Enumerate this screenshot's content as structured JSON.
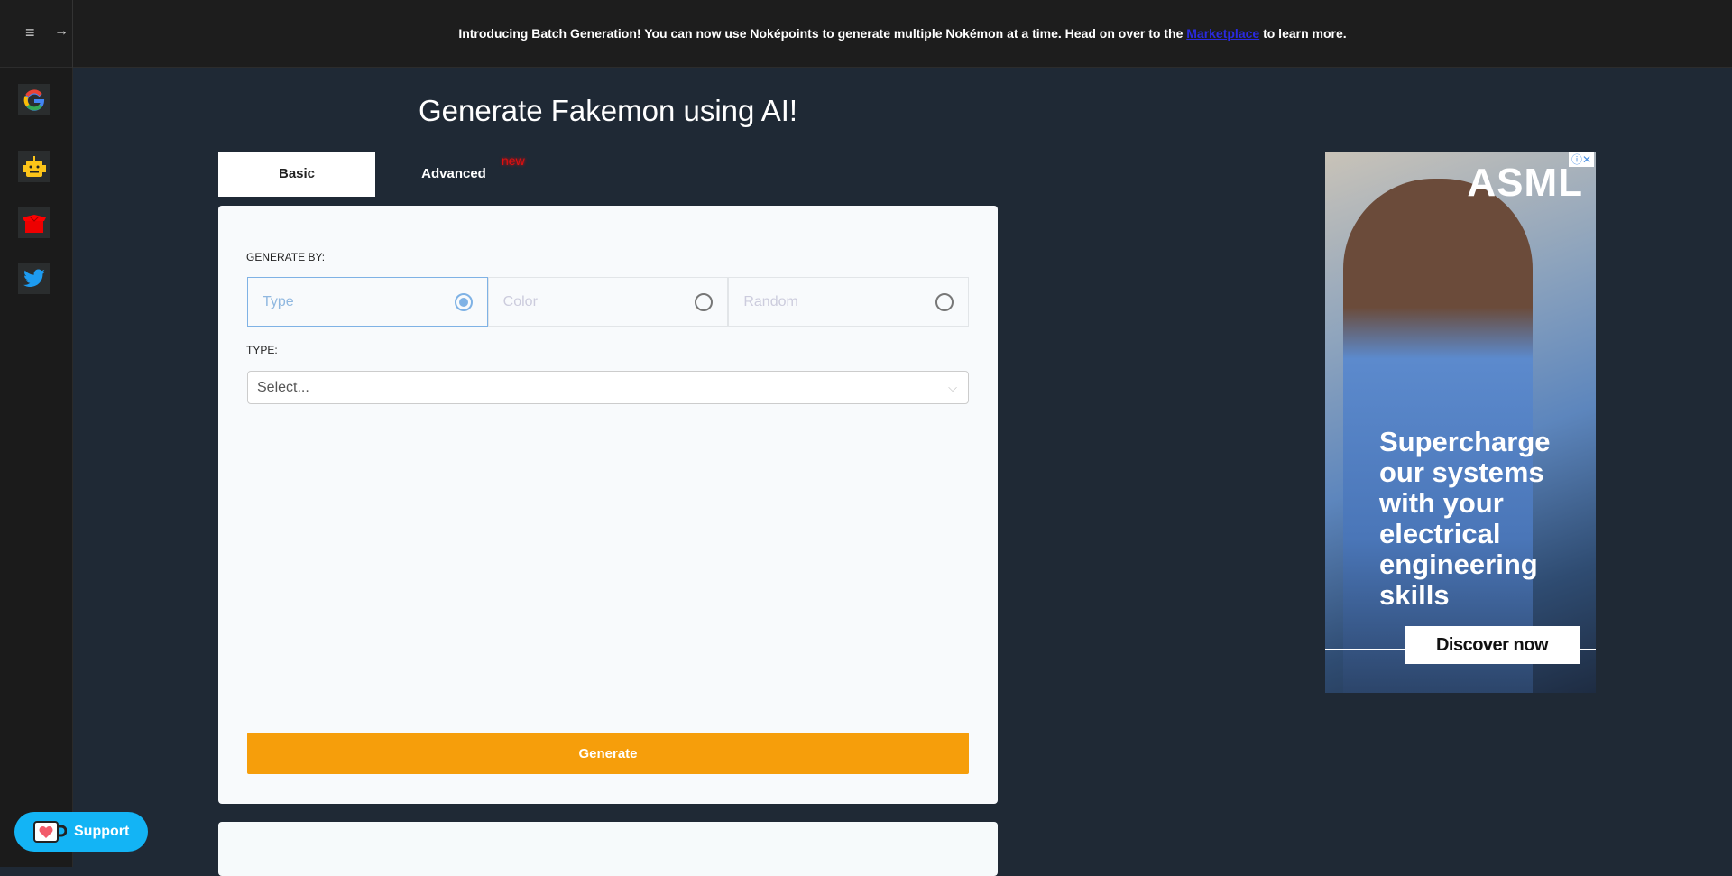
{
  "banner": {
    "text_before": "Introducing Batch Generation! You can now use Noképoints to generate multiple Nokémon at a time. Head on over to the",
    "link": "Marketplace",
    "text_after": "to learn more."
  },
  "topleft": {
    "menu_icon": "hamburger-icon",
    "expand_icon": "arrow-right-icon"
  },
  "sidebar": {
    "items": [
      {
        "icon": "google-icon"
      },
      {
        "icon": "robot-icon"
      },
      {
        "icon": "gift-box-icon"
      },
      {
        "icon": "twitter-icon"
      }
    ]
  },
  "main": {
    "title": "Generate Fakemon using AI!",
    "tabs": [
      {
        "label": "Basic",
        "active": true
      },
      {
        "label": "Advanced",
        "badge": "new"
      }
    ],
    "generate_by_label": "GENERATE BY:",
    "options": [
      {
        "label": "Type",
        "selected": true
      },
      {
        "label": "Color",
        "selected": false
      },
      {
        "label": "Random",
        "selected": false
      }
    ],
    "type_label": "TYPE:",
    "type_select_placeholder": "Select...",
    "generate_button": "Generate",
    "accent": "#f69e0b"
  },
  "ad": {
    "brand": "ASML",
    "headline": "Supercharge our systems with your electrical engineering skills",
    "cta": "Discover now"
  },
  "support": {
    "label": "Support",
    "color": "#13b4f5"
  }
}
